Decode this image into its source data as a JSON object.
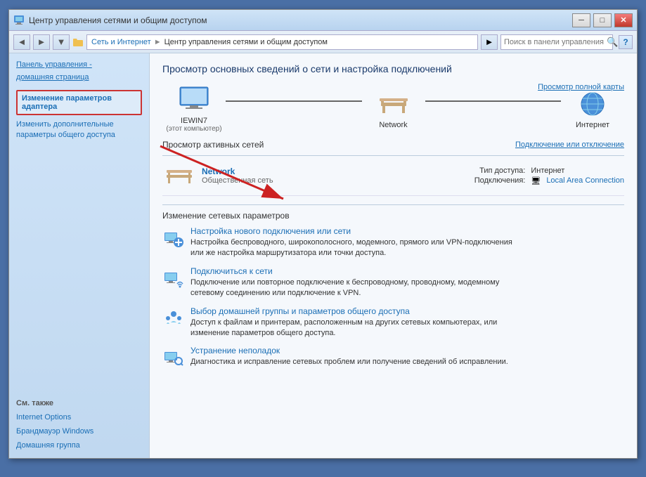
{
  "window": {
    "title": "Центр управления сетями и общим доступом",
    "minimize_label": "─",
    "maximize_label": "□",
    "close_label": "✕"
  },
  "addressbar": {
    "back_label": "◄",
    "forward_label": "►",
    "dropdown_label": "▼",
    "breadcrumb": {
      "part1": "Сеть и Интернет",
      "sep1": "►",
      "part2": "Центр управления сетями и общим доступом"
    },
    "go_label": "►",
    "search_placeholder": "Поиск в панели управления",
    "help_label": "?"
  },
  "sidebar": {
    "home_label": "Панель управления -",
    "home_label2": "домашняя страница",
    "adapter_settings": "Изменение параметров\nадаптера",
    "advanced_settings": "Изменить дополнительные\nпараметры общего доступа",
    "see_also": "См. также",
    "internet_options": "Internet Options",
    "windows_firewall": "Брандмауэр Windows",
    "home_group": "Домашняя группа"
  },
  "content": {
    "title": "Просмотр основных сведений о сети и настройка подключений",
    "view_full_map": "Просмотр полной карты",
    "network_nodes": [
      {
        "id": "computer",
        "label": "IEWIN7",
        "sublabel": "(этот компьютер)",
        "icon": "computer"
      },
      {
        "id": "network",
        "label": "Network",
        "sublabel": "",
        "icon": "network"
      },
      {
        "id": "internet",
        "label": "Интернет",
        "sublabel": "",
        "icon": "internet"
      }
    ],
    "active_networks_title": "Просмотр активных сетей",
    "connect_disconnect": "Подключение или отключение",
    "active_network": {
      "name": "Network",
      "type": "Общественная сеть",
      "access_type_label": "Тип доступа:",
      "access_type_value": "Интернет",
      "connections_label": "Подключения:",
      "connections_value": "Local Area Connection"
    },
    "change_section_title": "Изменение сетевых параметров",
    "change_items": [
      {
        "id": "new-connection",
        "link": "Настройка нового подключения или сети",
        "desc": "Настройка беспроводного, широкополосного, модемного, прямого или VPN-подключения\nили же настройка маршрутизатора или точки доступа."
      },
      {
        "id": "connect-to-network",
        "link": "Подключиться к сети",
        "desc": "Подключение или повторное подключение к беспроводному, проводному, модемному\nсетевому соединению или подключение к VPN."
      },
      {
        "id": "home-group",
        "link": "Выбор домашней группы и параметров общего доступа",
        "desc": "Доступ к файлам и принтерам, расположенным на других сетевых компьютерах, или\nизменение параметров общего доступа."
      },
      {
        "id": "troubleshoot",
        "link": "Устранение неполадок",
        "desc": "Диагностика и исправление сетевых проблем или получение сведений об исправлении."
      }
    ]
  },
  "colors": {
    "accent_blue": "#1a6eb5",
    "sidebar_bg": "#c8ddf0",
    "content_bg": "#f5f8fc",
    "border": "#bcd",
    "highlight_red": "#cc3333"
  }
}
